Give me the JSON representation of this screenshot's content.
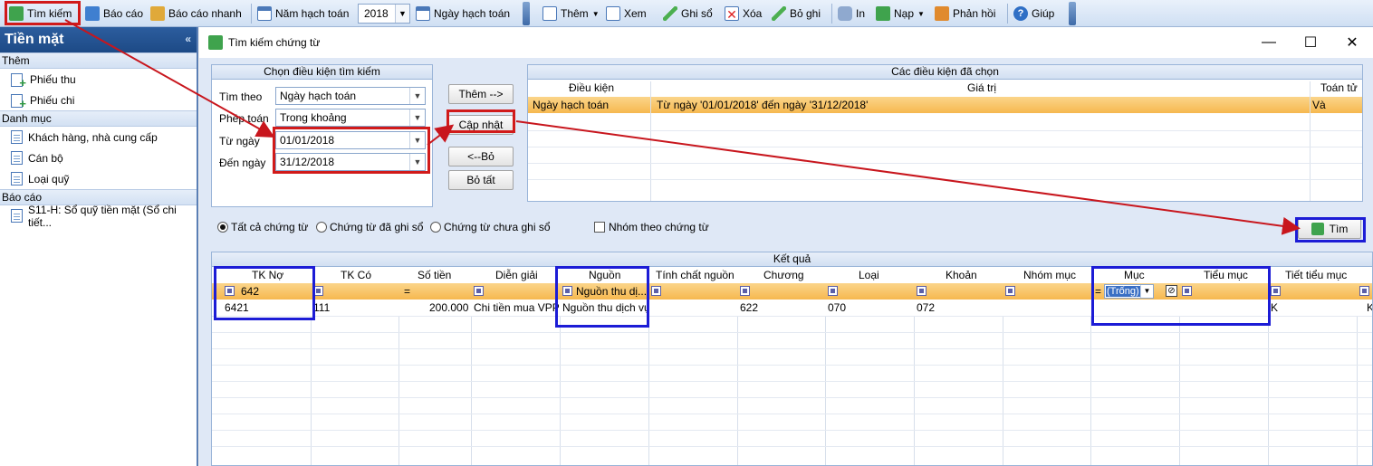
{
  "toolbar": {
    "search": "Tìm kiếm",
    "report": "Báo cáo",
    "quick_report": "Báo cáo nhanh",
    "fiscal_year_label": "Năm hạch toán",
    "fiscal_year_value": "2018",
    "posting_date": "Ngày hạch toán",
    "add": "Thêm",
    "view": "Xem",
    "post": "Ghi sổ",
    "delete": "Xóa",
    "unpost": "Bỏ ghi",
    "print": "In",
    "load": "Nạp",
    "feedback": "Phản hồi",
    "help": "Giúp"
  },
  "sidebar": {
    "title": "Tiền mặt",
    "groups": [
      {
        "label": "Thêm",
        "items": [
          "Phiếu thu",
          "Phiếu chi"
        ]
      },
      {
        "label": "Danh mục",
        "items": [
          "Khách hàng, nhà cung cấp",
          "Cán bộ",
          "Loại quỹ"
        ]
      },
      {
        "label": "Báo cáo",
        "items": [
          "S11-H: Sổ quỹ tiền mặt (Sổ chi tiết..."
        ]
      }
    ]
  },
  "dialog": {
    "title": "Tìm kiếm chứng từ",
    "criteria": {
      "header": "Chọn điều kiện tìm kiếm",
      "search_by_label": "Tìm theo",
      "search_by_value": "Ngày hạch toán",
      "operator_label": "Phép toán",
      "operator_value": "Trong khoảng",
      "from_label": "Từ ngày",
      "from_value": "01/01/2018",
      "to_label": "Đến ngày",
      "to_value": "31/12/2018"
    },
    "buttons": {
      "add": "Thêm -->",
      "update": "Cập nhật",
      "remove": "<--Bỏ",
      "remove_all": "Bỏ tất",
      "find": "Tìm"
    },
    "selected": {
      "header": "Các điều kiện đã chọn",
      "columns": [
        "Điều kiện",
        "Giá trị",
        "Toán tử"
      ],
      "rows": [
        {
          "condition": "Ngày hạch toán",
          "value": "Từ ngày '01/01/2018' đến ngày '31/12/2018'",
          "operator": "Và"
        }
      ]
    },
    "filters": {
      "all": "Tất cả chứng từ",
      "posted": "Chứng từ đã ghi sổ",
      "unposted": "Chứng từ chưa ghi sổ",
      "group_by": "Nhóm theo chứng từ"
    },
    "results": {
      "header": "Kết quả",
      "columns": [
        "TK Nợ",
        "TK Có",
        "Số tiền",
        "Diễn giải",
        "Nguồn",
        "Tính chất nguồn",
        "Chương",
        "Loại",
        "Khoản",
        "Nhóm mục",
        "Mục",
        "Tiểu mục",
        "Tiết tiểu mục"
      ],
      "filter_row": {
        "tk_no": "642",
        "so_tien_op": "=",
        "nguon": "Nguồn thu dị...",
        "muc_op": "=",
        "muc_value": "(Trống)"
      },
      "rows": [
        {
          "tk_no": "6421",
          "tk_co": "111",
          "so_tien": "200.000",
          "dien_giai": "Chi tiền mua VPP",
          "nguon": "Nguồn thu dịch vụ",
          "tinh_chat": "",
          "chuong": "622",
          "loai": "070",
          "khoan": "072",
          "nhom_muc": "",
          "muc": "",
          "tieu_muc": "",
          "tiet_tieu_muc": "K"
        }
      ]
    }
  }
}
